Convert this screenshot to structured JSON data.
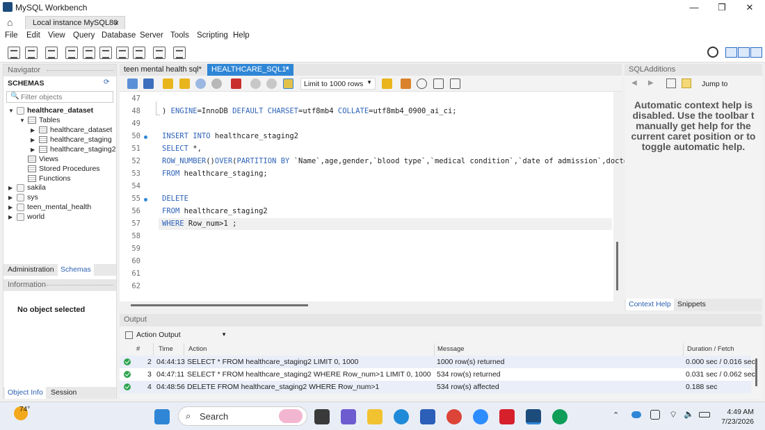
{
  "window": {
    "title": "MySQL Workbench",
    "minimize": "—",
    "restore": "❐",
    "close": "✕"
  },
  "connection_tab": {
    "label": "Local instance MySQL80",
    "close": "×"
  },
  "menu": [
    "File",
    "Edit",
    "View",
    "Query",
    "Database",
    "Server",
    "Tools",
    "Scripting",
    "Help"
  ],
  "navigator": {
    "header": "Navigator",
    "schemas_label": "SCHEMAS",
    "filter_placeholder": "Filter objects",
    "schemas": [
      {
        "name": "healthcare_dataset",
        "expanded": true
      },
      {
        "name": "sakila"
      },
      {
        "name": "sys"
      },
      {
        "name": "teen_mental_health"
      },
      {
        "name": "world"
      }
    ],
    "tables_label": "Tables",
    "tables": [
      "healthcare_dataset",
      "healthcare_staging",
      "healthcare_staging2"
    ],
    "views_label": "Views",
    "procedures_label": "Stored Procedures",
    "functions_label": "Functions",
    "tabs": [
      "Administration",
      "Schemas"
    ],
    "info_header": "Information",
    "info_text": "No object selected",
    "bottom_tabs": [
      "Object Info",
      "Session"
    ]
  },
  "editor_tabs": [
    {
      "label": "teen mental health sql*",
      "active": false
    },
    {
      "label": "HEALTHCARE_SQL1*",
      "active": true
    }
  ],
  "limit_select": "Limit to 1000 rows",
  "code_lines": [
    {
      "n": "47",
      "code": ""
    },
    {
      "n": "48",
      "code": ") ENGINE=InnoDB DEFAULT CHARSET=utf8mb4 COLLATE=utf8mb4_0900_ai_ci;"
    },
    {
      "n": "49",
      "code": ""
    },
    {
      "n": "50",
      "code": "INSERT INTO healthcare_staging2",
      "bp": true
    },
    {
      "n": "51",
      "code": "SELECT *,"
    },
    {
      "n": "52",
      "code": "ROW_NUMBER()OVER(PARTITION BY `Name`,age,gender,`blood type`,`medical condition`,`date of admission`,doctor,"
    },
    {
      "n": "53",
      "code": "FROM healthcare_staging;"
    },
    {
      "n": "54",
      "code": ""
    },
    {
      "n": "55",
      "code": "DELETE",
      "bp": true
    },
    {
      "n": "56",
      "code": "FROM healthcare_staging2"
    },
    {
      "n": "57",
      "code": "WHERE Row_num>1 ;"
    },
    {
      "n": "58",
      "code": ""
    },
    {
      "n": "59",
      "code": ""
    },
    {
      "n": "60",
      "code": ""
    },
    {
      "n": "61",
      "code": ""
    },
    {
      "n": "62",
      "code": ""
    }
  ],
  "sql_additions": {
    "header": "SQLAdditions",
    "jump_to": "Jump to",
    "help_lines": [
      "Automatic context help is",
      "disabled. Use the toolbar t",
      "manually get help for the",
      "current caret position or to",
      "toggle automatic help."
    ],
    "tabs": [
      "Context Help",
      "Snippets"
    ]
  },
  "output": {
    "header": "Output",
    "selector": "Action Output",
    "columns": [
      "#",
      "Time",
      "Action",
      "Message",
      "Duration / Fetch"
    ],
    "rows": [
      {
        "num": "2",
        "time": "04:44:13",
        "action": "SELECT * FROM healthcare_staging2 LIMIT 0, 1000",
        "message": "1000 row(s) returned",
        "duration": "0.000 sec / 0.016 sec"
      },
      {
        "num": "3",
        "time": "04:47:11",
        "action": "SELECT * FROM healthcare_staging2 WHERE Row_num>1 LIMIT 0, 1000",
        "message": "534 row(s) returned",
        "duration": "0.031 sec / 0.062 sec"
      },
      {
        "num": "4",
        "time": "04:48:56",
        "action": "DELETE FROM healthcare_staging2 WHERE Row_num>1",
        "message": "534 row(s) affected",
        "duration": "0.188 sec"
      }
    ]
  },
  "taskbar": {
    "temperature": "74°",
    "search": "Search",
    "time": "4:49 AM",
    "date": "7/23/2026"
  },
  "colors": {
    "accent": "#2f86d6",
    "keyword": "#2f63b8",
    "success": "#2ea44f"
  }
}
